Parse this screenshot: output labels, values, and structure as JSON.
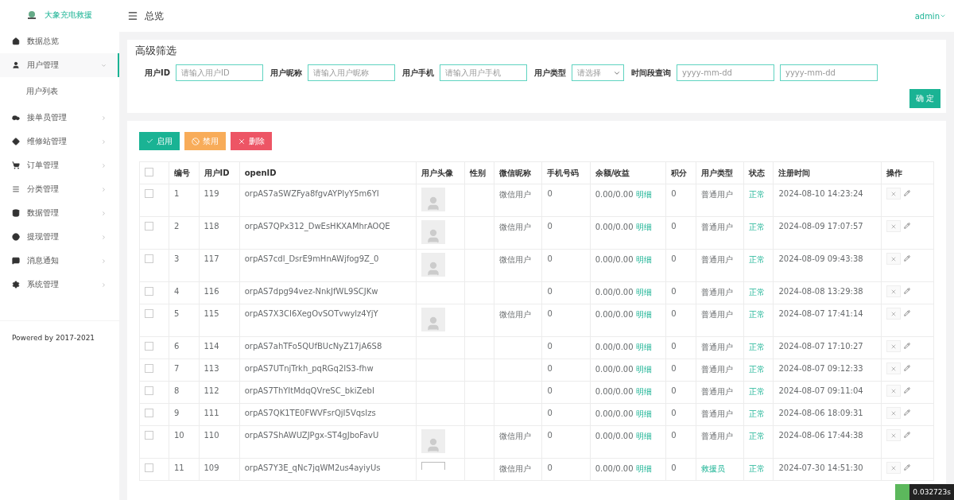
{
  "brand": {
    "name": "大象充电救援"
  },
  "sidebar": {
    "items": [
      {
        "label": "数据总览",
        "selected": false,
        "expanded": false,
        "has_children": false
      },
      {
        "label": "用户管理",
        "selected": true,
        "expanded": true,
        "has_children": true,
        "children": [
          {
            "label": "用户列表",
            "selected": false
          }
        ]
      },
      {
        "label": "接单员管理",
        "selected": false,
        "expanded": false,
        "has_children": true
      },
      {
        "label": "维修站管理",
        "selected": false,
        "expanded": false,
        "has_children": true
      },
      {
        "label": "订单管理",
        "selected": false,
        "expanded": false,
        "has_children": true
      },
      {
        "label": "分类管理",
        "selected": false,
        "expanded": false,
        "has_children": true
      },
      {
        "label": "数据管理",
        "selected": false,
        "expanded": false,
        "has_children": true
      },
      {
        "label": "提现管理",
        "selected": false,
        "expanded": false,
        "has_children": true
      },
      {
        "label": "消息通知",
        "selected": false,
        "expanded": false,
        "has_children": true
      },
      {
        "label": "系统管理",
        "selected": false,
        "expanded": false,
        "has_children": true
      }
    ],
    "footer": "Powered by 2017-2021"
  },
  "topbar": {
    "title": "总览",
    "user": "admin"
  },
  "filter": {
    "title": "高级筛选",
    "fields": [
      {
        "kind": "input",
        "label": "用户ID",
        "placeholder": "请输入用户ID"
      },
      {
        "kind": "input",
        "label": "用户昵称",
        "placeholder": "请输入用户昵称"
      },
      {
        "kind": "input",
        "label": "用户手机",
        "placeholder": "请输入用户手机"
      },
      {
        "kind": "select",
        "label": "用户类型",
        "placeholder": "请选择"
      },
      {
        "kind": "daterange",
        "label": "时间段查询",
        "placeholder": "yyyy-mm-dd",
        "placeholder_end": "yyyy-mm-dd"
      }
    ],
    "submit": "确 定"
  },
  "actions": [
    {
      "kind": "enable",
      "label": "启用"
    },
    {
      "kind": "disable",
      "label": "禁用"
    },
    {
      "kind": "delete",
      "label": "删除"
    }
  ],
  "table": {
    "all_checked": false,
    "columns": [
      "编号",
      "用户ID",
      "openID",
      "用户头像",
      "性别",
      "微信昵称",
      "手机号码",
      "余额/收益",
      "积分",
      "用户类型",
      "状态",
      "注册时间",
      "操作"
    ],
    "rows": [
      {
        "no": "1",
        "user_id": "119",
        "openid": "orpAS7aSWZFya8fgvAYPIyY5m6YI",
        "avatar": {
          "kind": "placeholder"
        },
        "nickname": "微信用户",
        "phone": "0",
        "balance": "0.00/0.00",
        "detail": "明细",
        "points": "0",
        "user_type": {
          "label": "普通用户",
          "kind": "normal"
        },
        "status": "正常",
        "time": "2024-08-10 14:23:24",
        "checked": false
      },
      {
        "no": "2",
        "user_id": "118",
        "openid": "orpAS7QPx312_DwEsHKXAMhrAOQE",
        "avatar": {
          "kind": "placeholder"
        },
        "nickname": "微信用户",
        "phone": "0",
        "balance": "0.00/0.00",
        "detail": "明细",
        "points": "0",
        "user_type": {
          "label": "普通用户",
          "kind": "normal"
        },
        "status": "正常",
        "time": "2024-08-09 17:07:57",
        "checked": false
      },
      {
        "no": "3",
        "user_id": "117",
        "openid": "orpAS7cdl_DsrE9mHnAWjfog9Z_0",
        "avatar": {
          "kind": "placeholder"
        },
        "nickname": "微信用户",
        "phone": "0",
        "balance": "0.00/0.00",
        "detail": "明细",
        "points": "0",
        "user_type": {
          "label": "普通用户",
          "kind": "normal"
        },
        "status": "正常",
        "time": "2024-08-09 09:43:38",
        "checked": false
      },
      {
        "no": "4",
        "user_id": "116",
        "openid": "orpAS7dpg94vez-NnkJfWL9SCJKw",
        "phone": "0",
        "balance": "0.00/0.00",
        "detail": "明细",
        "points": "0",
        "user_type": {
          "label": "普通用户",
          "kind": "normal"
        },
        "status": "正常",
        "time": "2024-08-08 13:29:38",
        "checked": false
      },
      {
        "no": "5",
        "user_id": "115",
        "openid": "orpAS7X3CI6XegOvSOTvwylz4YjY",
        "avatar": {
          "kind": "placeholder"
        },
        "nickname": "微信用户",
        "phone": "0",
        "balance": "0.00/0.00",
        "detail": "明细",
        "points": "0",
        "user_type": {
          "label": "普通用户",
          "kind": "normal"
        },
        "status": "正常",
        "time": "2024-08-07 17:41:14",
        "checked": false
      },
      {
        "no": "6",
        "user_id": "114",
        "openid": "orpAS7ahTFo5QUfBUcNyZ17jA6S8",
        "phone": "0",
        "balance": "0.00/0.00",
        "detail": "明细",
        "points": "0",
        "user_type": {
          "label": "普通用户",
          "kind": "normal"
        },
        "status": "正常",
        "time": "2024-08-07 17:10:27",
        "checked": false
      },
      {
        "no": "7",
        "user_id": "113",
        "openid": "orpAS7UTnjTrkh_pqRGq2IS3-fhw",
        "phone": "0",
        "balance": "0.00/0.00",
        "detail": "明细",
        "points": "0",
        "user_type": {
          "label": "普通用户",
          "kind": "normal"
        },
        "status": "正常",
        "time": "2024-08-07 09:12:33",
        "checked": false
      },
      {
        "no": "8",
        "user_id": "112",
        "openid": "orpAS7ThYItMdqQVreSC_bkiZebI",
        "phone": "0",
        "balance": "0.00/0.00",
        "detail": "明细",
        "points": "0",
        "user_type": {
          "label": "普通用户",
          "kind": "normal"
        },
        "status": "正常",
        "time": "2024-08-07 09:11:04",
        "checked": false
      },
      {
        "no": "9",
        "user_id": "111",
        "openid": "orpAS7QK1TE0FWVFsrQjI5VqsIzs",
        "phone": "0",
        "balance": "0.00/0.00",
        "detail": "明细",
        "points": "0",
        "user_type": {
          "label": "普通用户",
          "kind": "normal"
        },
        "status": "正常",
        "time": "2024-08-06 18:09:31",
        "checked": false
      },
      {
        "no": "10",
        "user_id": "110",
        "openid": "orpAS7ShAWUZJPgx-ST4gJboFavU",
        "avatar": {
          "kind": "placeholder"
        },
        "nickname": "微信用户",
        "phone": "0",
        "balance": "0.00/0.00",
        "detail": "明细",
        "points": "0",
        "user_type": {
          "label": "普通用户",
          "kind": "normal"
        },
        "status": "正常",
        "time": "2024-08-06 17:44:38",
        "checked": false
      },
      {
        "no": "11",
        "user_id": "109",
        "openid": "orpAS7Y3E_qNc7jqWM2us4ayiyUs",
        "avatar": {
          "kind": "broken"
        },
        "nickname": "微信用户",
        "phone": "0",
        "balance": "0.00/0.00",
        "detail": "明细",
        "points": "0",
        "user_type": {
          "label": "救援员",
          "kind": "rescuer"
        },
        "status": "正常",
        "time": "2024-07-30 14:51:30",
        "checked": false
      }
    ]
  },
  "trace": {
    "time": "0.032723s"
  }
}
